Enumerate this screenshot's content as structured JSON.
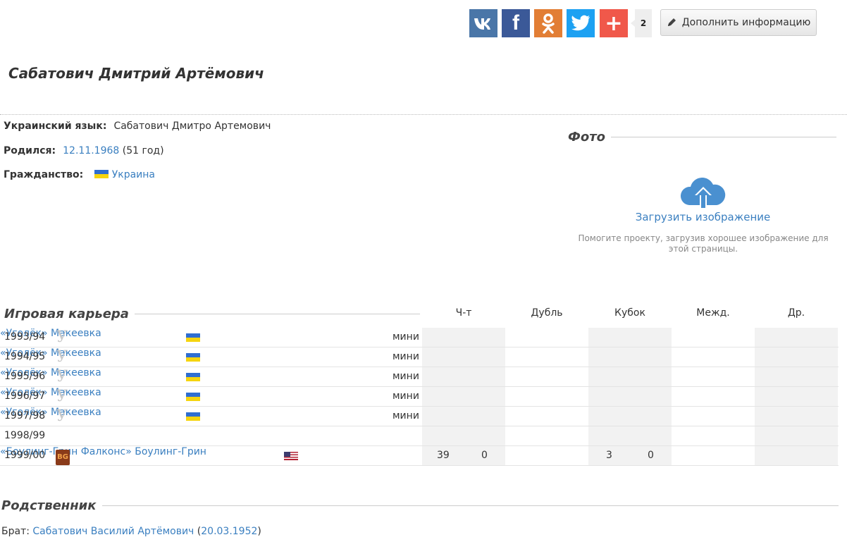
{
  "social": {
    "vk": "vk-icon",
    "facebook": "f",
    "odnoklassniki": "ok-icon",
    "twitter": "twitter-icon",
    "plus": "+",
    "count": "2"
  },
  "edit_button": {
    "label": "Дополнить информацию",
    "icon": "pencil-icon"
  },
  "person": {
    "name": "Сабатович Дмитрий Артёмович",
    "ukrainian_label": "Украинский язык:",
    "ukrainian_name": "Сабатович Дмитро Артемович",
    "born_label": "Родился:",
    "born_date": "12.11.1968",
    "born_age": "(51 год)",
    "citizenship_label": "Гражданство:",
    "citizenship": "Украина"
  },
  "photo": {
    "heading": "Фото",
    "upload_label": "Загрузить изображение",
    "help": "Помогите проекту, загрузив хорошее изображение для этой страницы."
  },
  "career": {
    "heading": "Игровая карьера",
    "columns": [
      "Ч-т",
      "Дубль",
      "Кубок",
      "Межд.",
      "Др."
    ],
    "rows": [
      {
        "season": "1993/94",
        "icon": "У",
        "club": "«Уголёк» Макеевка",
        "flag": "ua",
        "league": "мини",
        "champ_games": "",
        "champ_goals": "",
        "cup_games": "",
        "cup_goals": ""
      },
      {
        "season": "1994/95",
        "icon": "У",
        "club": "«Уголёк» Макеевка",
        "flag": "ua",
        "league": "мини",
        "champ_games": "",
        "champ_goals": "",
        "cup_games": "",
        "cup_goals": ""
      },
      {
        "season": "1995/96",
        "icon": "У",
        "club": "«Уголёк» Макеевка",
        "flag": "ua",
        "league": "мини",
        "champ_games": "",
        "champ_goals": "",
        "cup_games": "",
        "cup_goals": ""
      },
      {
        "season": "1996/97",
        "icon": "У",
        "club": "«Уголёк» Макеевка",
        "flag": "ua",
        "league": "мини",
        "champ_games": "",
        "champ_goals": "",
        "cup_games": "",
        "cup_goals": ""
      },
      {
        "season": "1997/98",
        "icon": "У",
        "club": "«Уголёк» Макеевка",
        "flag": "ua",
        "league": "мини",
        "champ_games": "",
        "champ_goals": "",
        "cup_games": "",
        "cup_goals": ""
      },
      {
        "season": "1998/99",
        "icon": "",
        "club": "",
        "flag": "",
        "league": "",
        "champ_games": "",
        "champ_goals": "",
        "cup_games": "",
        "cup_goals": ""
      },
      {
        "season": "1999/00",
        "icon": "BG",
        "club": "«Боулинг-Грин Фалконс» Боулинг-Грин",
        "flag": "us",
        "league": "",
        "champ_games": "39",
        "champ_goals": "0",
        "cup_games": "3",
        "cup_goals": "0"
      }
    ]
  },
  "relative": {
    "heading": "Родственник",
    "label": "Брат:",
    "name": "Сабатович Василий Артёмович",
    "open_paren": "(",
    "date": "20.03.1952",
    "close_paren": ")"
  }
}
